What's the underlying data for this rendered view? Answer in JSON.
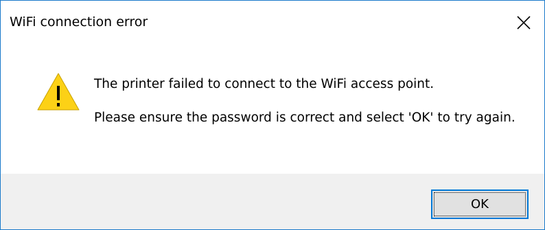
{
  "window": {
    "title": "WiFi connection error",
    "close_icon": "close-icon"
  },
  "message": {
    "icon": "warning-icon",
    "line1": "The printer failed to connect to the WiFi access point.",
    "line2": "Please ensure the password is correct and select 'OK' to try again."
  },
  "buttons": {
    "ok_label": "OK"
  },
  "colors": {
    "border": "#1979ca",
    "footer_bg": "#f0f0f0",
    "button_focus_border": "#0078d7",
    "warning_fill": "#fcd116"
  }
}
